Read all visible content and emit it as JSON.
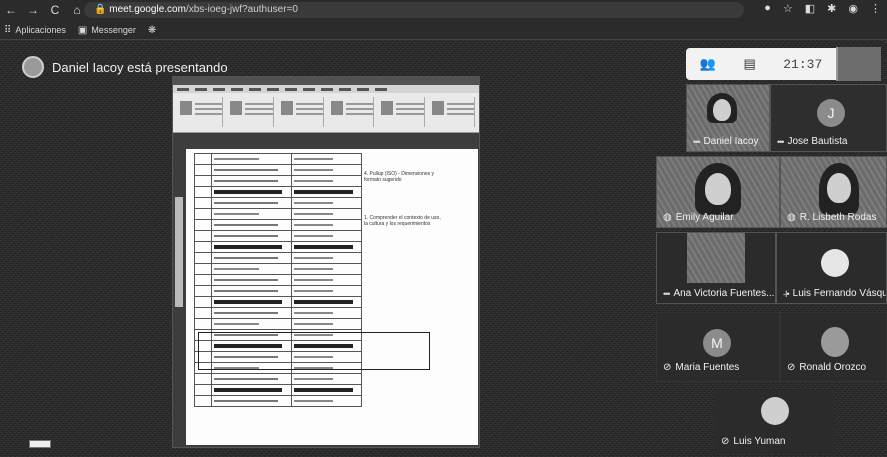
{
  "browser": {
    "url_domain": "meet.google.com",
    "url_path": "/xbs-ioeg-jwf?authuser=0",
    "clock": "21:37"
  },
  "bookmarks": [
    {
      "label": "Aplicaciones"
    },
    {
      "label": "Messenger"
    }
  ],
  "presenter": {
    "text": "Daniel Iacoy está presentando"
  },
  "document": {
    "notes": [
      "4. Pullup (ISO) - Dimensiones y formato sugerido",
      "1. Comprender el contexto de uso, la cultura y los requerimientos"
    ]
  },
  "participants": [
    {
      "name": "Daniel Iacoy"
    },
    {
      "name": "Jose Bautista",
      "initial": "J"
    },
    {
      "name": "Emily Aguilar"
    },
    {
      "name": "R. Lisbeth Rodas"
    },
    {
      "name": "Ana Victoria Fuentes..."
    },
    {
      "name": "Luis Fernando Vásqu"
    },
    {
      "name": "Maria Fuentes",
      "initial": "M"
    },
    {
      "name": "Ronald Orozco"
    },
    {
      "name": "Luis Yuman"
    }
  ],
  "colors": {
    "background": "#262626",
    "toolbar": "#f2f2f2"
  }
}
